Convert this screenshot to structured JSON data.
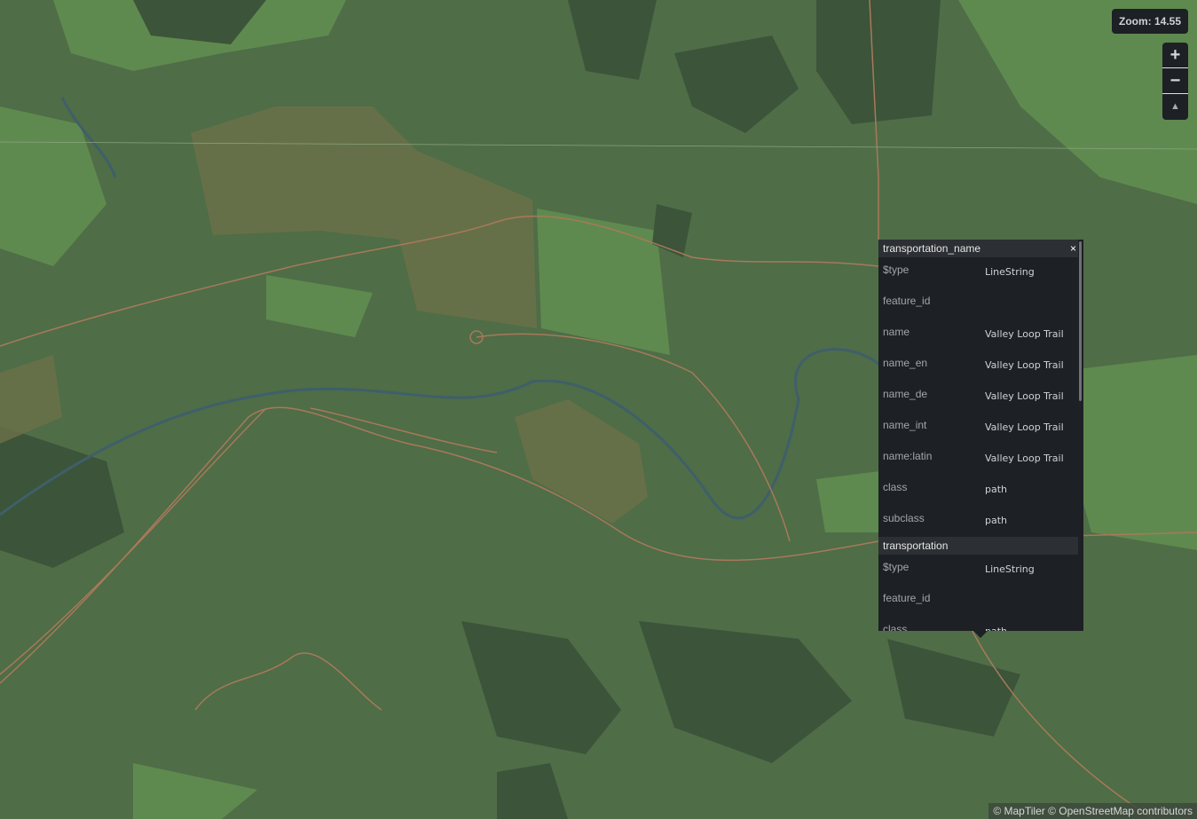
{
  "map": {
    "zoom_label": "Zoom: 14.55",
    "colors": {
      "background": "#4f6d47",
      "forest_dark": "#3c5439",
      "grass_light": "#5f8a4f",
      "road": "#a8795a",
      "water": "#3f5f6a",
      "residential": "#6c7048"
    },
    "controls": {
      "zoom_in_icon": "plus-icon",
      "zoom_out_icon": "minus-icon",
      "compass_icon": "compass-icon"
    }
  },
  "popup": {
    "sections": [
      {
        "title": "transportation_name",
        "rows": [
          {
            "key": "$type",
            "value": "LineString"
          },
          {
            "key": "feature_id",
            "value": ""
          },
          {
            "key": "name",
            "value": "Valley Loop Trail"
          },
          {
            "key": "name_en",
            "value": "Valley Loop Trail"
          },
          {
            "key": "name_de",
            "value": "Valley Loop Trail"
          },
          {
            "key": "name_int",
            "value": "Valley Loop Trail"
          },
          {
            "key": "name:latin",
            "value": "Valley Loop Trail"
          },
          {
            "key": "class",
            "value": "path"
          },
          {
            "key": "subclass",
            "value": "path"
          }
        ]
      },
      {
        "title": "transportation",
        "rows": [
          {
            "key": "$type",
            "value": "LineString"
          },
          {
            "key": "feature_id",
            "value": ""
          },
          {
            "key": "class",
            "value": "path"
          }
        ]
      }
    ],
    "close_label": "×"
  },
  "attribution": "© MapTiler © OpenStreetMap contributors"
}
